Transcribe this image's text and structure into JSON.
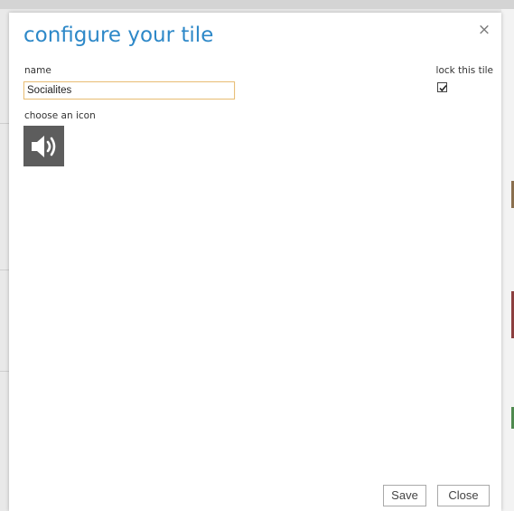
{
  "dialog": {
    "title": "configure your tile",
    "close_glyph": "×",
    "close_icon": "close-icon"
  },
  "form": {
    "name_label": "name",
    "name_value": "Socialites",
    "lock_label": "lock this tile",
    "lock_checked": true,
    "icon_label": "choose an icon",
    "selected_icon": "speaker-volume-icon"
  },
  "buttons": {
    "save": "Save",
    "close": "Close"
  },
  "colors": {
    "title": "#2d88c8",
    "icon_tile": "#5d5d5d",
    "input_focus_border": "#e8bf7a"
  }
}
